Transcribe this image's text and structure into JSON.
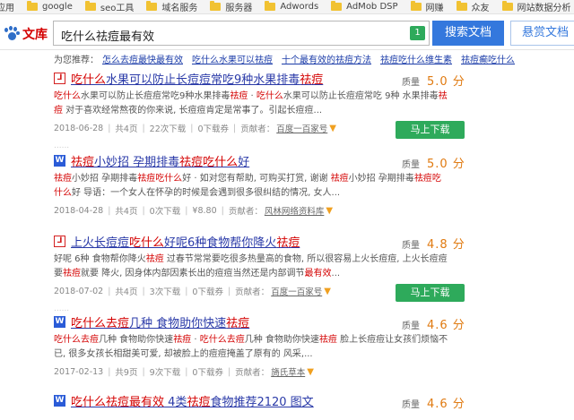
{
  "bookmarks": [
    "应用",
    "google",
    "seo工具",
    "域名服务",
    "服务器",
    "Adwords",
    "AdMob DSP",
    "网赚",
    "众友",
    "网站数据分析"
  ],
  "header": {
    "logo_du": "百度",
    "logo_wk": "文库",
    "search_value": "吃什么祛痘最有效",
    "badge": "1",
    "search_button": "搜索文档",
    "reward_button": "悬赏文档"
  },
  "suggest": {
    "label": "为您推荐：",
    "items": [
      "怎么去痘最快最有效",
      "吃什么水果可以祛痘",
      "十个最有效的祛痘方法",
      "祛痘吃什么维生素",
      "祛痘癫吃什么"
    ]
  },
  "quality_label": "质量",
  "download_label": "马上下载",
  "results": [
    {
      "icon": "PDF",
      "title": "吃什么水果可以防止长痘痘常吃9种水果排毒祛痘",
      "snippet": "吃什么水果可以防止长痘痘常吃9种水果排毒祛痘 · 吃什么水果可以防止长痘痘常吃 9种 水果排毒祛痘 对于喜欢经常熬夜的你来说, 长痘痘肯定是常事了。引起长痘痘...",
      "date": "2018-06-28",
      "pages": "共4页",
      "views": "22次下载",
      "coupons": "0下载券",
      "uploader_label": "贡献者：",
      "uploader": "百度一百家号",
      "score": "5.0 分"
    },
    {
      "icon": "W",
      "title": "祛痘小妙招 孕期排毒祛痘吃什么好",
      "snippet": "祛痘小妙招 孕期排毒祛痘吃什么好 · 如对您有帮助, 可购买打赏, 谢谢 祛痘小妙招 孕期排毒祛痘吃什么好 导语：一个女人在怀孕的时候是会遇到很多很纠结的情况, 女人...",
      "date": "2018-04-28",
      "pages": "共4页",
      "views": "0次下载",
      "coupons": "¥8.80",
      "uploader_label": "贡献者：",
      "uploader": "风林网络资料库",
      "score": "5.0 分"
    },
    {
      "icon": "PDF",
      "title": "上火长痘痘吃什么好呢6种食物帮你降火祛痘",
      "snippet": "好呢 6种 食物帮你降火祛痘 过春节常常要吃很多热量高的食物, 所以很容易上火长痘痘, 上火长痘痘要祛痘就要 降火, 因身体内部因素长出的痘痘当然还是内部调节最有效...",
      "date": "2018-07-02",
      "pages": "共4页",
      "views": "3次下载",
      "coupons": "0下载券",
      "uploader_label": "贡献者：",
      "uploader": "百度一百家号",
      "score": "4.8 分"
    },
    {
      "icon": "W",
      "title": "吃什么去痘几种 食物助你快速祛痘",
      "snippet": "吃什么去痘几种 食物助你快速祛痘 · 吃什么去痘几种 食物助你快速祛痘 脸上长痘痘让女孩们烦恼不已, 很多女孩长相甜美可爱, 却被脸上的痘痘掩盖了原有的 风采,...",
      "date": "2017-02-13",
      "pages": "共9页",
      "views": "9次下载",
      "coupons": "0下载券",
      "uploader_label": "贡献者：",
      "uploader": "旖氏草本",
      "score": "4.6 分"
    },
    {
      "icon": "W",
      "title": "吃什么祛痘最有效 4类祛痘食物推荐2120 图文",
      "score": "4.6 分"
    }
  ]
}
